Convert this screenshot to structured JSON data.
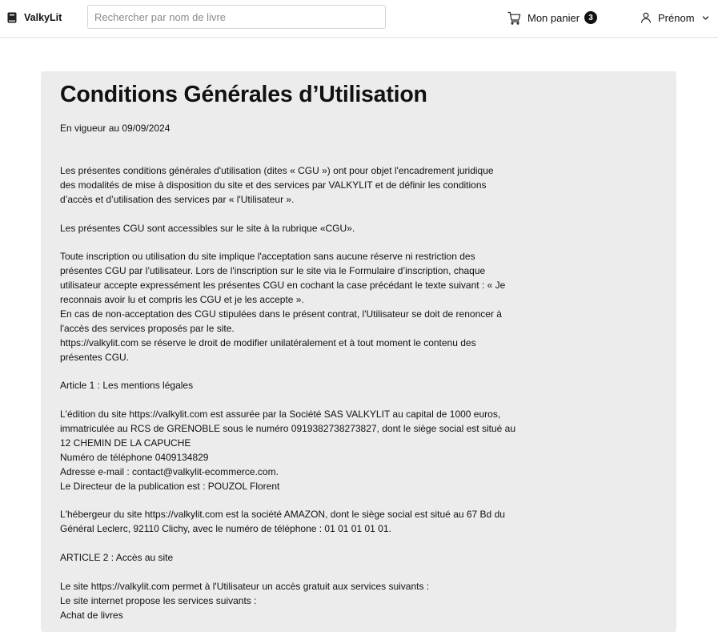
{
  "header": {
    "brand": "ValkyLit",
    "search_placeholder": "Rechercher par nom de livre",
    "cart_label": "Mon panier",
    "cart_count": "3",
    "user_label": "Prénom"
  },
  "page": {
    "title": "Conditions Générales d’Utilisation",
    "effective_date": "En vigueur au 09/09/2024"
  },
  "body_lines": [
    "Les présentes conditions générales d'utilisation (dites « CGU ») ont pour objet l'encadrement juridique",
    "des modalités de mise à disposition du site et des services par VALKYLIT  et de définir les conditions",
    "d’accès et d’utilisation des services par « l'Utilisateur ».",
    "",
    "Les présentes CGU sont accessibles sur le site à la rubrique «CGU».",
    "",
    "Toute inscription ou utilisation du site implique l'acceptation sans aucune réserve ni restriction des",
    "présentes CGU par l’utilisateur. Lors de l'inscription sur le site via le Formulaire d’inscription, chaque",
    "utilisateur accepte expressément les présentes CGU en cochant la case précédant le texte suivant : « Je",
    "reconnais avoir lu et compris les CGU et je les accepte ».",
    "En cas de non-acceptation des CGU stipulées dans le présent contrat, l'Utilisateur se doit de renoncer à",
    "l'accès des services proposés par le site.",
    "https://valkylit.com  se réserve le droit de modifier unilatéralement et à tout moment le contenu des",
    "présentes CGU.",
    "",
    "Article 1 : Les mentions légales",
    "",
    "L'édition du site https://valkylit.com est assurée par la Société SAS VALKYLIT au capital de 1000 euros,",
    "immatriculée au RCS de GRENOBLE sous le numéro 0919382738273827, dont le siège social est situé au",
    "12 CHEMIN DE LA CAPUCHE",
    "Numéro de téléphone 0409134829",
    "Adresse e-mail : contact@valkylit-ecommerce.com.",
    "Le Directeur de la publication est : POUZOL Florent",
    "",
    "L'hébergeur du site https://valkylit.com est la société AMAZON, dont le siège social est situé au 67 Bd du",
    "Général Leclerc, 92110 Clichy, avec le numéro de téléphone : 01 01 01 01 01.",
    "",
    "ARTICLE 2 : Accès au site",
    "",
    "Le site https://valkylit.com  permet à l'Utilisateur un accès gratuit aux services suivants :",
    "Le site internet propose les services suivants :",
    "Achat de livres"
  ]
}
